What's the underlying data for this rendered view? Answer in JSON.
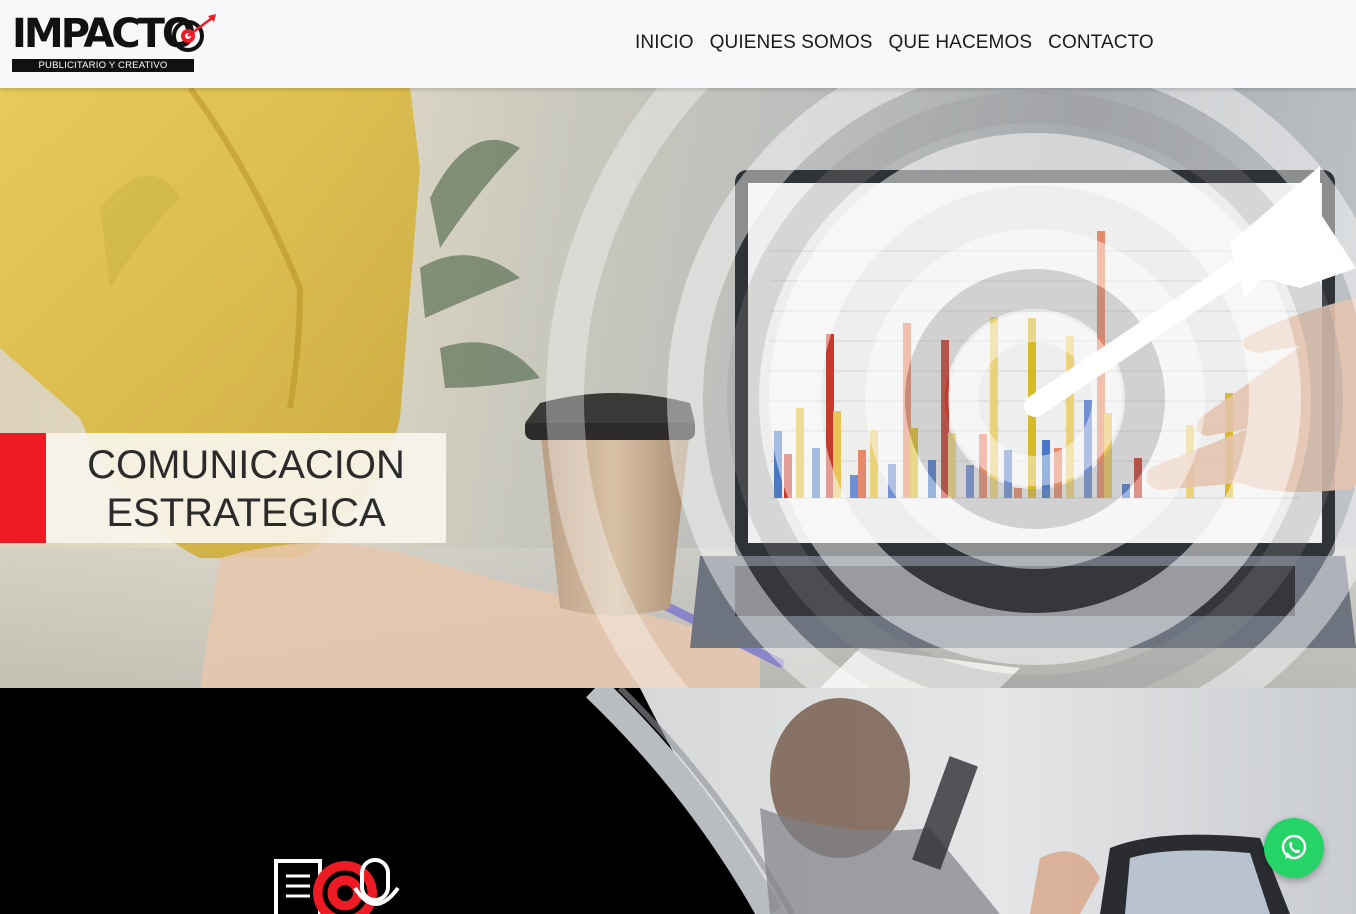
{
  "brand": {
    "name": "IMPACTO",
    "tagline": "PUBLICITARIO Y CREATIVO"
  },
  "nav": {
    "items": [
      "INICIO",
      "QUIENES SOMOS",
      "QUE HACEMOS",
      "CONTACTO"
    ]
  },
  "hero": {
    "caption_line1": "COMUNICACION",
    "caption_line2": "ESTRATEGICA"
  },
  "icons": {
    "whatsapp": "whatsapp-icon",
    "services": "document-target-microphone-icon",
    "logo_mark": "target-arrow-icon"
  },
  "colors": {
    "accent_red": "#ee1b24",
    "whatsapp_green": "#25d366",
    "header_bg": "#f7f8f9",
    "section_bg": "#000000"
  }
}
